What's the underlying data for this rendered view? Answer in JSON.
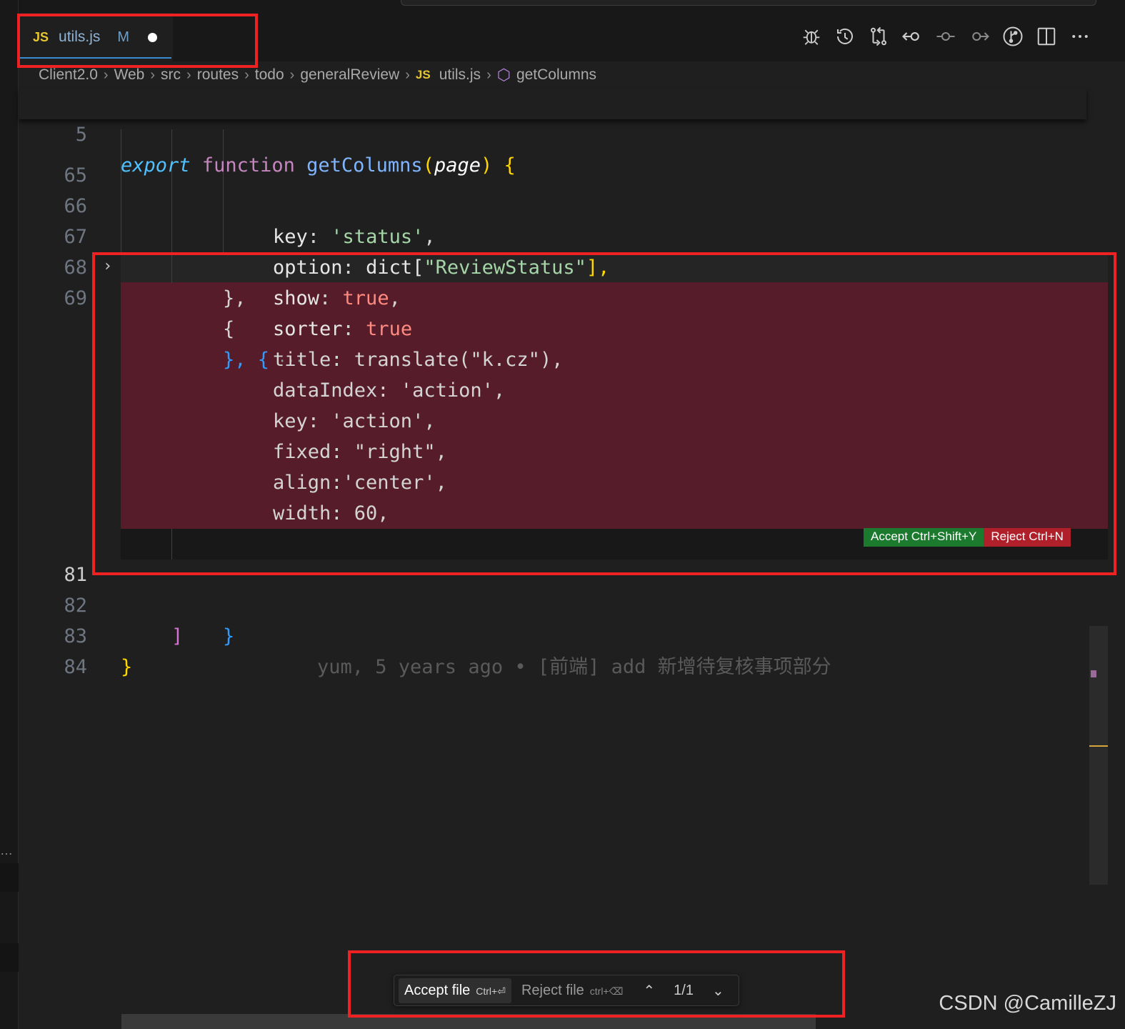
{
  "tab": {
    "icon": "JS",
    "name": "utils.js",
    "status": "M"
  },
  "toolbar_icons": [
    "debug-icon",
    "history-icon",
    "compare-changes-icon",
    "go-back-icon",
    "commit-icon",
    "go-forward-icon",
    "git-graph-icon",
    "split-editor-icon",
    "more-actions-icon"
  ],
  "breadcrumb": {
    "items": [
      "Client2.0",
      "Web",
      "src",
      "routes",
      "todo",
      "generalReview"
    ],
    "file_icon": "JS",
    "file": "utils.js",
    "symbol": "getColumns"
  },
  "editor": {
    "sticky": {
      "line": "5",
      "keyword1": "export",
      "keyword2": "function",
      "name": "getColumns",
      "param": "page"
    },
    "lines": [
      {
        "num": "65",
        "key": "key",
        "value": "'status'"
      },
      {
        "num": "66",
        "key": "option",
        "value_pre": "dict[",
        "value_str": "\"ReviewStatus\"",
        "value_post": "],"
      },
      {
        "num": "67",
        "key": "show",
        "value": "true"
      },
      {
        "num": "68",
        "key": "sorter",
        "value": "true"
      },
      {
        "num": "69",
        "text": "}, {",
        "ellipsis": "···"
      }
    ],
    "deleted_lines": [
      "},",
      "{",
      "title: translate(\"k.cz\"),",
      "dataIndex: 'action',",
      "key: 'action',",
      "fixed: \"right\",",
      "align:'center',",
      "width: 60,"
    ],
    "line81": {
      "num": "81",
      "text": "}",
      "blame": "yum, 5 years ago • [前端] add 新增待复核事项部分"
    },
    "line82": {
      "num": "82",
      "text": "]"
    },
    "line83": {
      "num": "83",
      "text": "}"
    },
    "line84": {
      "num": "84"
    }
  },
  "inline_actions": {
    "accept": "Accept Ctrl+Shift+Y",
    "reject": "Reject Ctrl+N"
  },
  "file_bar": {
    "accept": "Accept file",
    "accept_kbd": "Ctrl+⏎",
    "reject": "Reject file",
    "reject_kbd": "ctrl+⌫",
    "count": "1/1"
  },
  "watermark": "CSDN @CamilleZJ",
  "colors": {
    "deleted_bg": "#561c2a",
    "highlight_box": "#ee2222",
    "accept": "#1b7a2e",
    "reject": "#b0202a"
  }
}
